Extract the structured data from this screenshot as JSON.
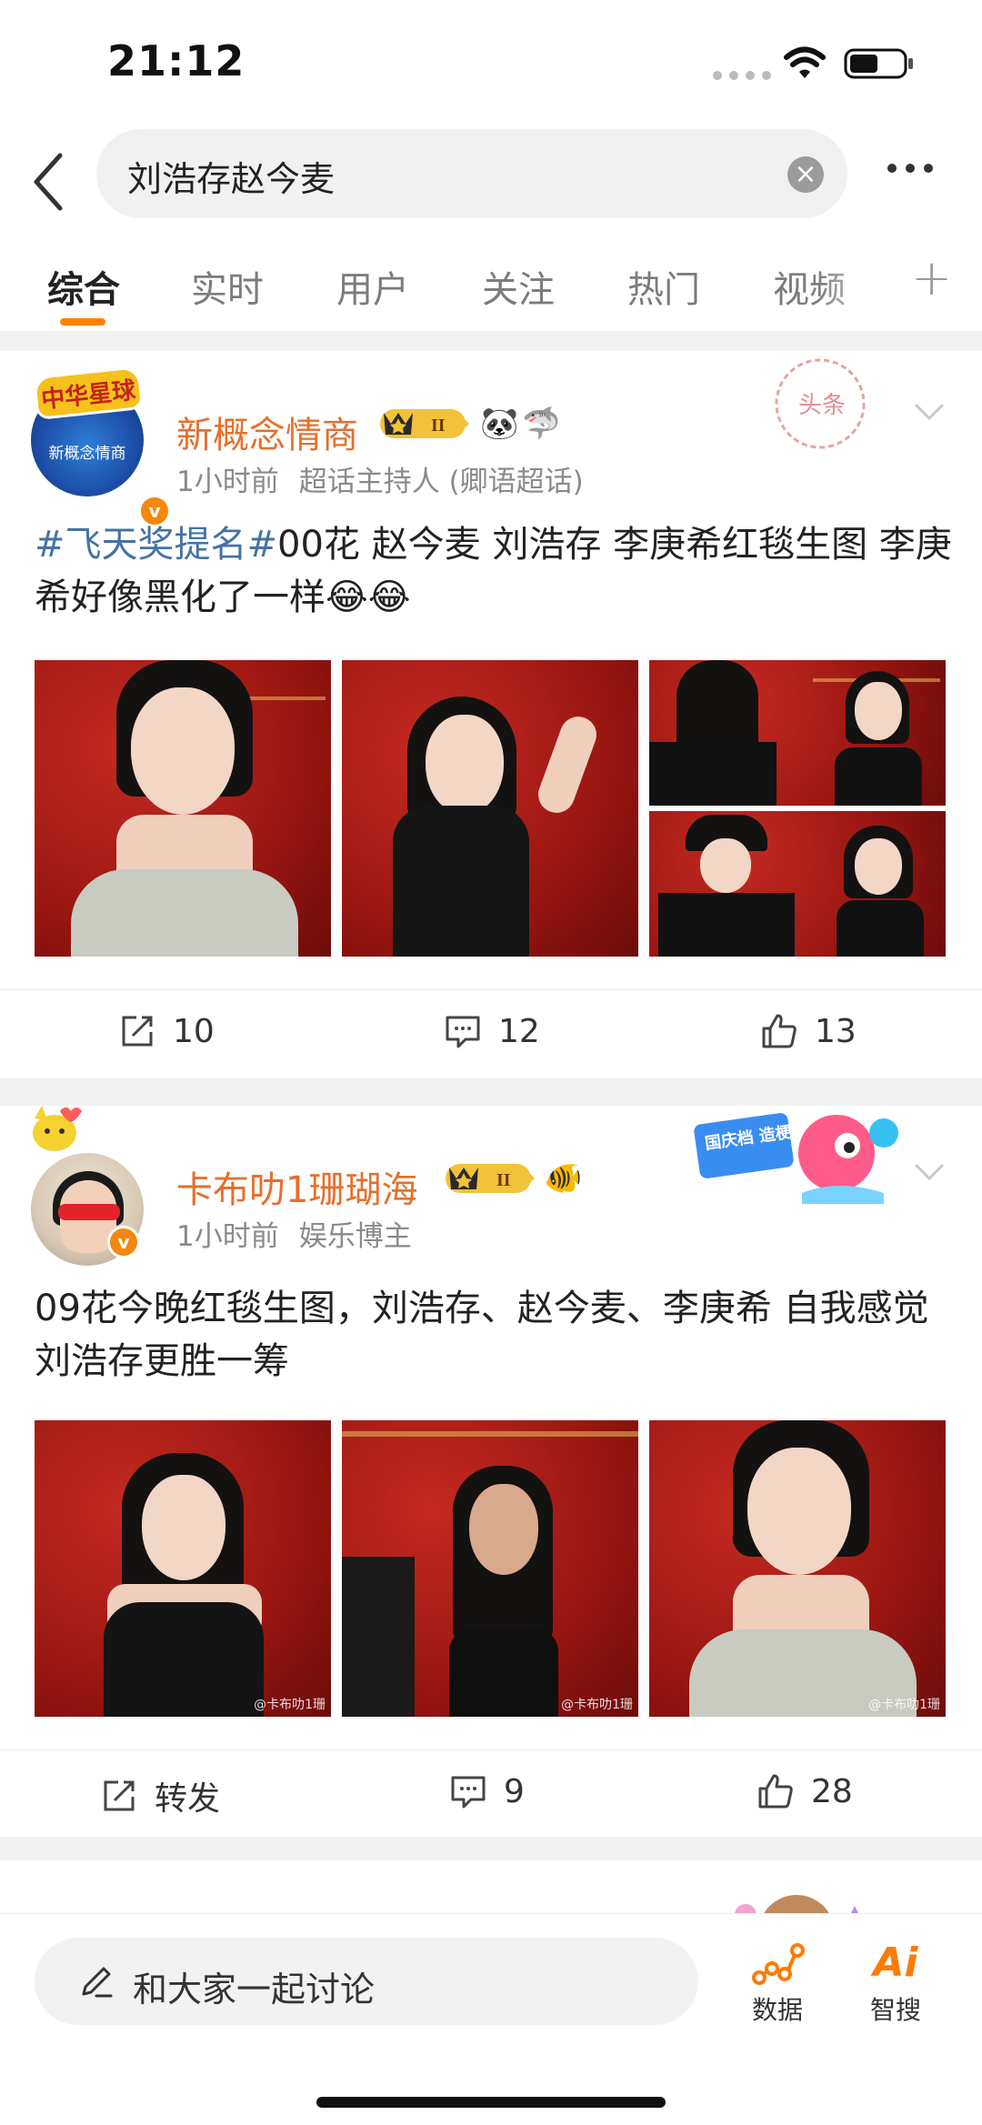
{
  "status_bar": {
    "time": "21:12"
  },
  "search": {
    "query": "刘浩存赵今麦"
  },
  "tabs": [
    {
      "label": "综合"
    },
    {
      "label": "实时"
    },
    {
      "label": "用户"
    },
    {
      "label": "关注"
    },
    {
      "label": "热门"
    },
    {
      "label": "视频"
    }
  ],
  "posts": [
    {
      "user_name": "新概念情商",
      "avatar_text": "新概念情商",
      "avatar_deco": "中华星球",
      "time": "1小时前",
      "role": "超话主持人 (卿语超话)",
      "stamp_label": "头条",
      "hashtag": "#飞天奖提名#",
      "text": "00花 赵今麦 刘浩存 李庚希红毯生图 李庚希好像黑化了一样😂😂",
      "repost": "10",
      "comments": "12",
      "likes": "13"
    },
    {
      "user_name": "卡布叻1珊瑚海",
      "time": "1小时前",
      "role": "娱乐博主",
      "promo_label": "国庆档 造梗高手",
      "text": "09花今晚红毯生图，刘浩存、赵今麦、李庚希 自我感觉刘浩存更胜一筹",
      "repost": "转发",
      "comments": "9",
      "likes": "28",
      "photo_captions": [
        "@卡布叻1珊",
        "@卡布叻1珊",
        "@卡布叻1珊"
      ]
    }
  ],
  "bottom_bar": {
    "comment_placeholder": "和大家一起讨论",
    "data_label": "数据",
    "ai_label": "智搜",
    "ai_icon": "Ai"
  },
  "colors": {
    "accent": "#ff8200",
    "username": "#e5702d",
    "hashtag": "#4572a6"
  }
}
